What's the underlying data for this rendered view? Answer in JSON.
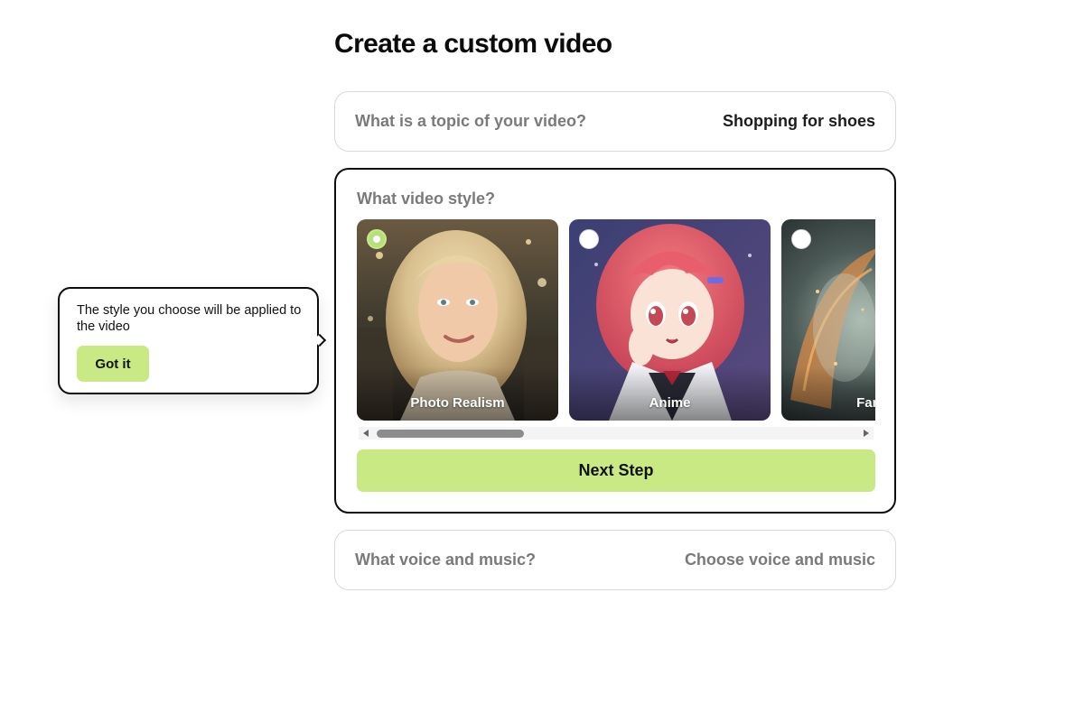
{
  "page": {
    "title": "Create a custom video"
  },
  "topic": {
    "question": "What is a topic of your video?",
    "value": "Shopping for shoes"
  },
  "style": {
    "question": "What video style?",
    "options": [
      {
        "label": "Photo Realism",
        "selected": true
      },
      {
        "label": "Anime",
        "selected": false
      },
      {
        "label": "Fantasy",
        "selected": false
      }
    ],
    "next_label": "Next Step"
  },
  "voice": {
    "question": "What voice and music?",
    "value": "Choose voice and music"
  },
  "tooltip": {
    "text": "The style you choose will be applied to the video",
    "button_label": "Got it"
  },
  "colors": {
    "accent": "#c9e984",
    "selected_radio": "#b8e07a",
    "border": "#0d0d0d",
    "muted_text": "#7a7a7a"
  }
}
